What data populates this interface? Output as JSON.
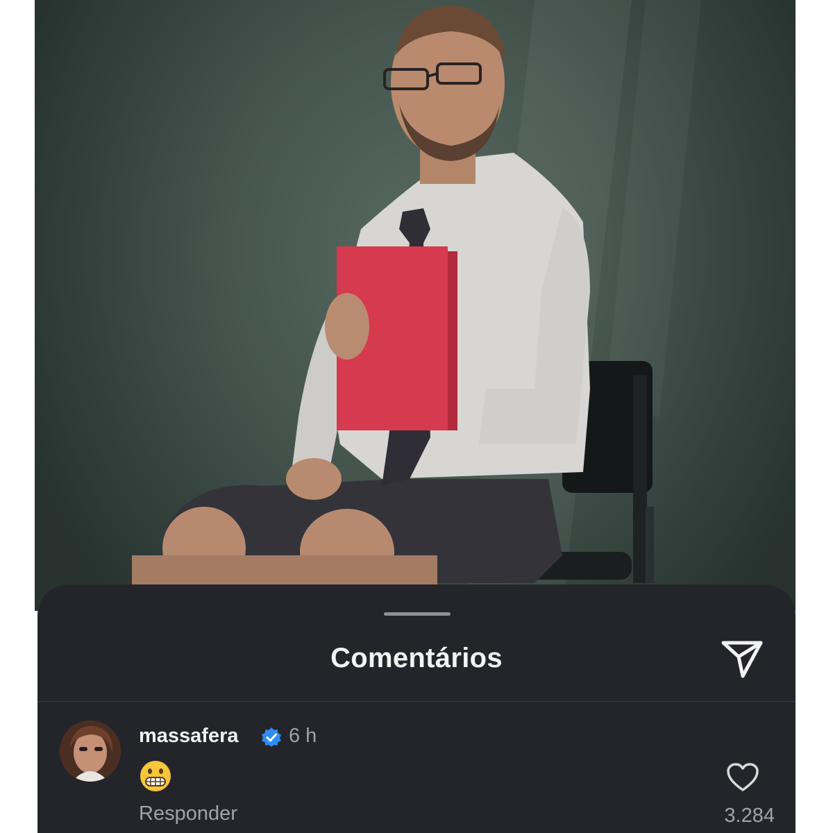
{
  "sheet": {
    "title": "Comentários",
    "share_icon": "send-icon"
  },
  "comment": {
    "username": "massafera",
    "verified": true,
    "time": "6 h",
    "text_emoji": "grimacing-face-emoji",
    "reply_label": "Responder",
    "like_count": "3.284",
    "like_icon": "heart-outline-icon"
  },
  "colors": {
    "sheet_bg": "#24252a",
    "photo_bg": "#46564f",
    "verified": "#2f8cf3",
    "text_primary": "#f1f1f1",
    "text_secondary": "#a2a3a8"
  }
}
